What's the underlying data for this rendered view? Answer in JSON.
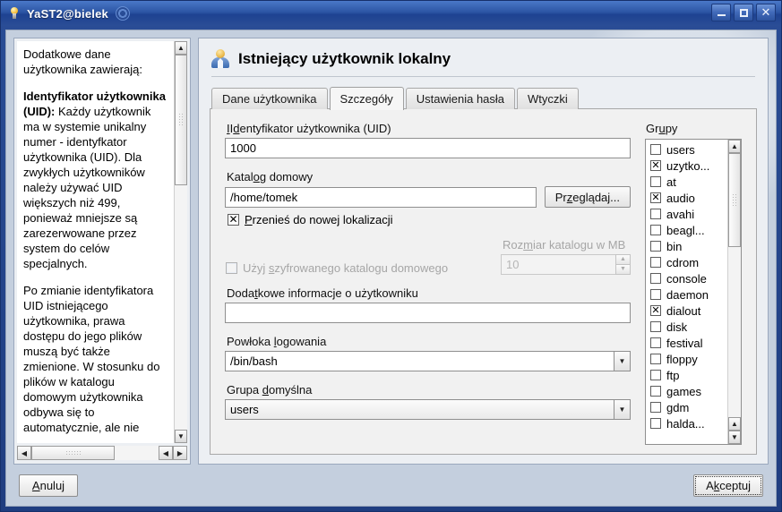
{
  "window": {
    "title": "YaST2@bielek",
    "icons": {
      "app": "lightbulb-icon",
      "brand": "suse-logo-icon"
    },
    "controls": {
      "minimize": "minimize-icon",
      "maximize": "maximize-icon",
      "close": "close-icon"
    }
  },
  "help": {
    "paragraphs": [
      {
        "lead": "Dodatkowe dane użytkownika zawierają:"
      },
      {
        "heading": "Identyfikator użytkownika (UID):",
        "body": "Każdy użytkownik ma w systemie unikalny numer - identyfkator użytkownika (UID). Dla zwykłych użytkowników należy używać UID większych niż 499, ponieważ mniejsze są zarezerwowane przez system do celów specjalnych."
      },
      {
        "body": "Po zmianie identyfikatora UID istniejącego użytkownika, prawa dostępu do jego plików muszą być także zmienione. W stosunku do plików w katalogu domowym użytkownika odbywa się to automatycznie, ale nie"
      }
    ],
    "scroll_up": "▲",
    "scroll_down": "▼",
    "scroll_left": "◀",
    "scroll_right": "▶"
  },
  "page": {
    "title": "Istniejący użytkownik lokalny",
    "icon": "user-icon"
  },
  "tabs": [
    {
      "label": "Dane użytkownika",
      "active": false
    },
    {
      "label": "Szczegóły",
      "active": true
    },
    {
      "label": "Ustawienia hasła",
      "active": false
    },
    {
      "label": "Wtyczki",
      "active": false
    }
  ],
  "form": {
    "uid": {
      "label": "Identyfikator użytkownika (UID)",
      "value": "1000"
    },
    "home": {
      "label": "Katalog domowy",
      "value": "/home/tomek",
      "browse_button": "Przeglądaj..."
    },
    "move": {
      "label": "Przenieś do nowej lokalizacji",
      "checked": true
    },
    "encrypt": {
      "label": "Użyj szyfrowanego katalogu domowego",
      "checked": false,
      "disabled": true
    },
    "dirsize": {
      "label": "Rozmiar katalogu w MB",
      "value": "10",
      "disabled": true,
      "up": "▲",
      "down": "▼"
    },
    "extra": {
      "label": "Dodatkowe informacje o użytkowniku",
      "value": ""
    },
    "shell": {
      "label": "Powłoka logowania",
      "value": "/bin/bash",
      "arrow": "▼"
    },
    "defgroup": {
      "label": "Grupa domyślna",
      "value": "users",
      "arrow": "▼"
    }
  },
  "groups": {
    "label": "Grupy",
    "items": [
      {
        "name": "users",
        "checked": false
      },
      {
        "name": "uzytko...",
        "checked": true
      },
      {
        "name": "at",
        "checked": false
      },
      {
        "name": "audio",
        "checked": true
      },
      {
        "name": "avahi",
        "checked": false
      },
      {
        "name": "beagl...",
        "checked": false
      },
      {
        "name": "bin",
        "checked": false
      },
      {
        "name": "cdrom",
        "checked": false
      },
      {
        "name": "console",
        "checked": false
      },
      {
        "name": "daemon",
        "checked": false
      },
      {
        "name": "dialout",
        "checked": true
      },
      {
        "name": "disk",
        "checked": false
      },
      {
        "name": "festival",
        "checked": false
      },
      {
        "name": "floppy",
        "checked": false
      },
      {
        "name": "ftp",
        "checked": false
      },
      {
        "name": "games",
        "checked": false
      },
      {
        "name": "gdm",
        "checked": false
      },
      {
        "name": "halda...",
        "checked": false
      }
    ],
    "scroll_up": "▲",
    "scroll_down": "▼"
  },
  "footer": {
    "cancel": "Anuluj",
    "accept": "Akceptuj"
  },
  "colors": {
    "titlebar_blue": "#2a4d96",
    "client_bg": "#c4cfde",
    "panel_bg": "#eceff3",
    "tabpane_bg": "#f1f1f1"
  }
}
